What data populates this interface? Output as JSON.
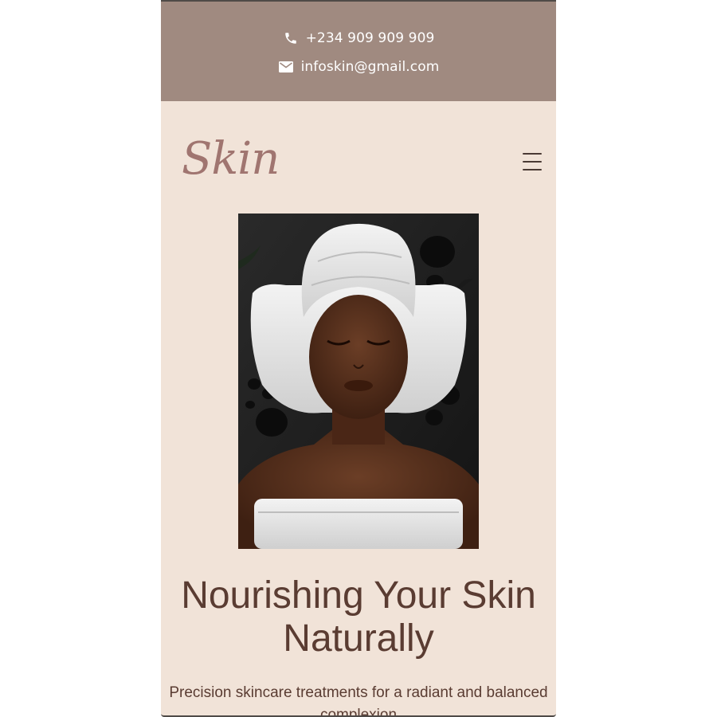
{
  "topbar": {
    "phone_icon": "phone-icon",
    "phone": "+234 909 909 909",
    "email_icon": "mail-icon",
    "email": "infoskin@gmail.com"
  },
  "header": {
    "logo": "Skin",
    "menu_icon": "hamburger-menu-icon"
  },
  "hero": {
    "image": "spa-woman-towel-photo",
    "title": "Nourishing Your Skin Naturally",
    "subtitle": "Precision skincare treatments for a radiant and balanced complexion"
  },
  "colors": {
    "topbar_bg": "#a08a80",
    "page_bg": "#f1e3d8",
    "logo": "#a07570",
    "heading": "#5a3c32"
  }
}
